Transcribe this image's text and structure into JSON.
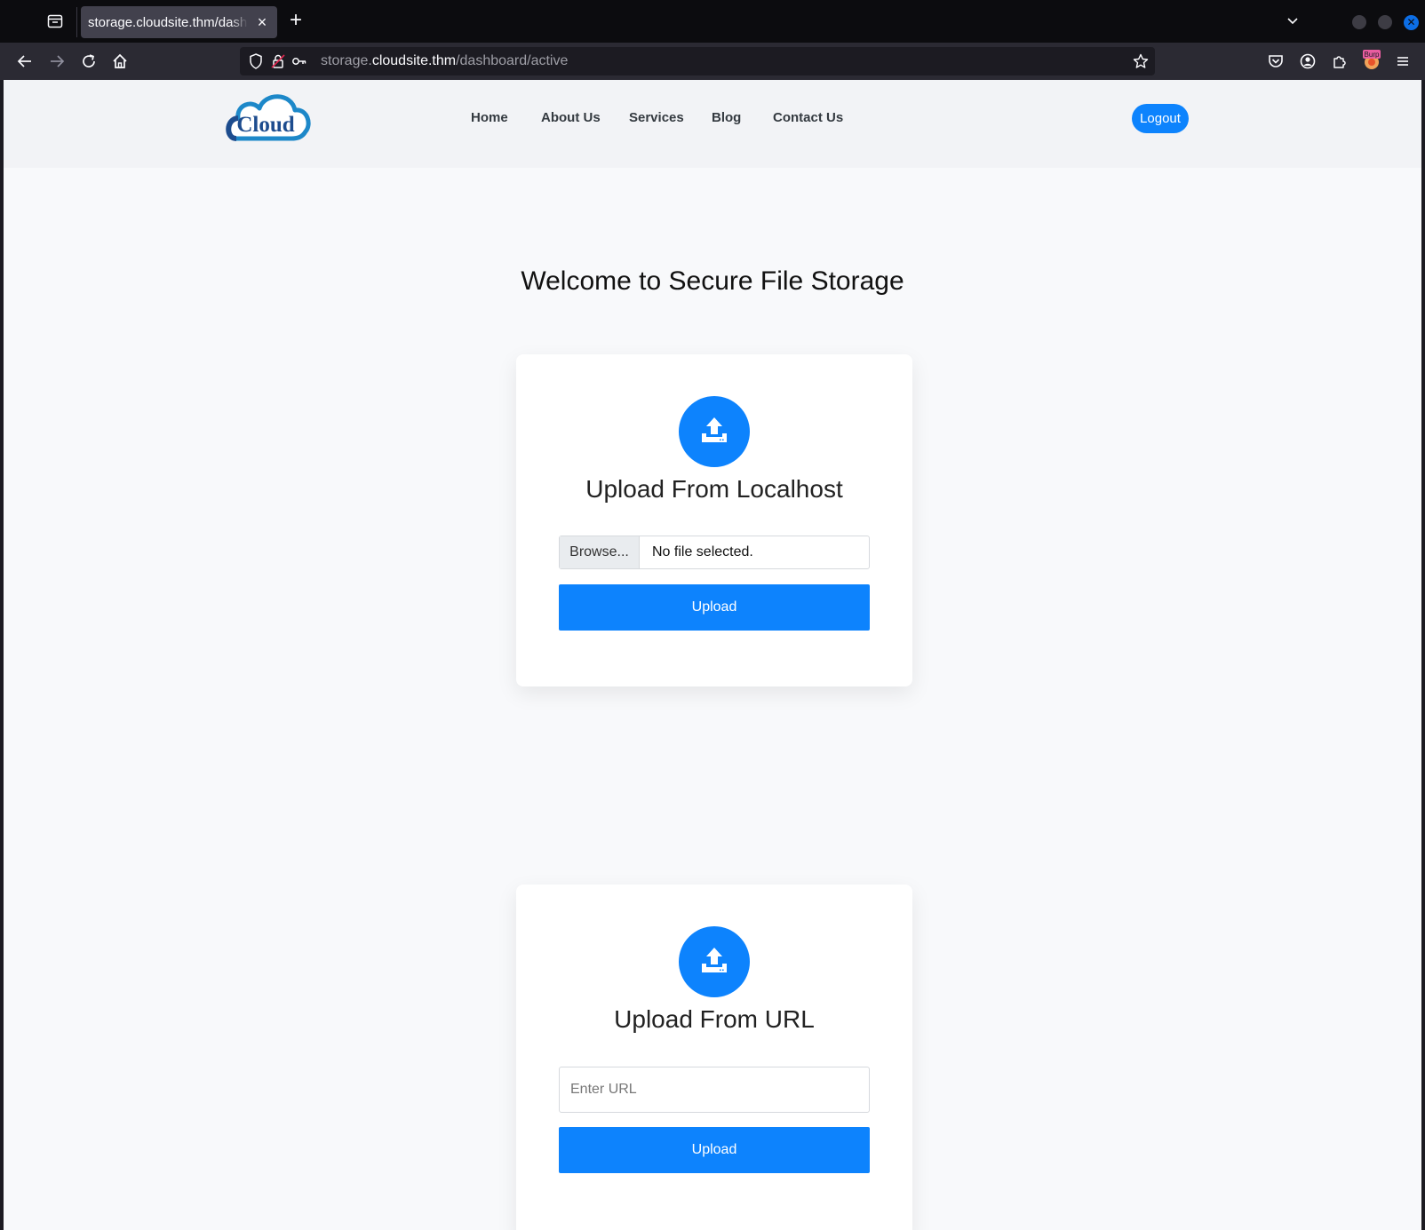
{
  "browser": {
    "tab_title": "storage.cloudsite.thm/dashboard/active",
    "tab_close": "×",
    "new_tab": "+",
    "url_host_prefix": "storage.",
    "url_host_main": "cloudsite.thm",
    "url_path": "/dashboard/active",
    "extension_badge": "Burp"
  },
  "header": {
    "logo_text": "Cloud",
    "nav": [
      "Home",
      "About Us",
      "Services",
      "Blog",
      "Contact Us"
    ],
    "logout_label": "Logout"
  },
  "main": {
    "heading": "Welcome to Secure File Storage",
    "local_upload": {
      "title": "Upload From Localhost",
      "browse_label": "Browse...",
      "file_status": "No file selected.",
      "upload_label": "Upload"
    },
    "url_upload": {
      "title": "Upload From URL",
      "url_placeholder": "Enter URL",
      "upload_label": "Upload"
    }
  },
  "colors": {
    "accent": "#0d83fd",
    "page_bg": "#f8f9fb",
    "header_bg": "#f2f3f6"
  }
}
